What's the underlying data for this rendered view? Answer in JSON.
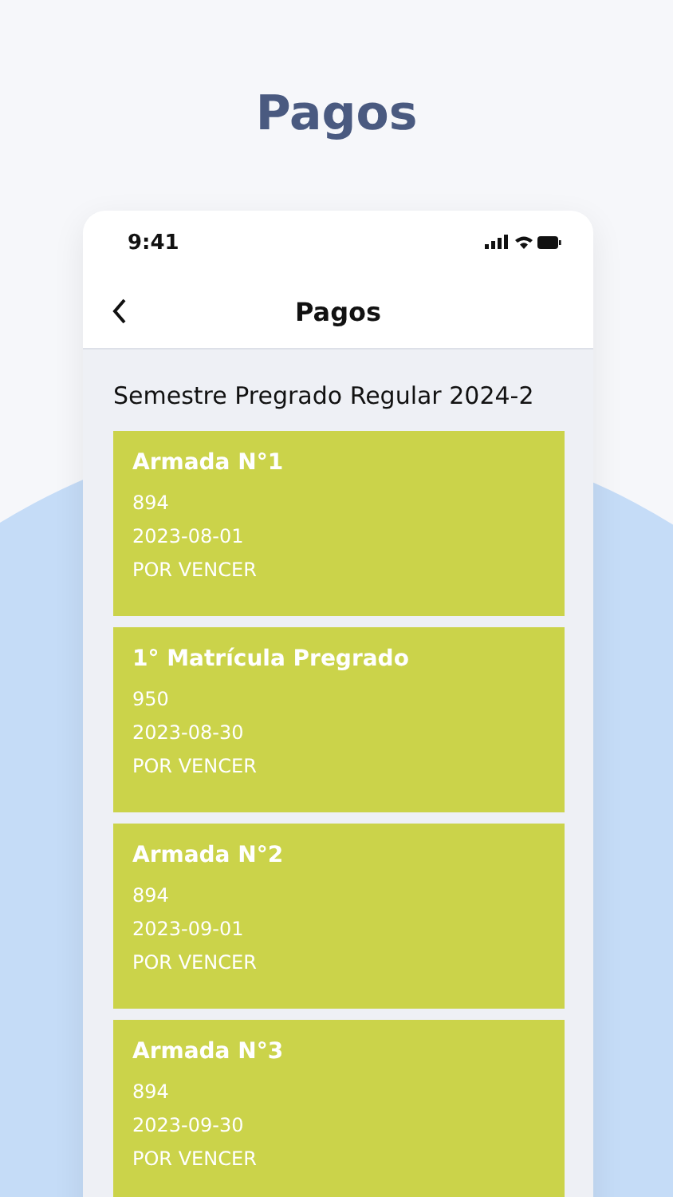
{
  "heading": "Pagos",
  "status_bar": {
    "time": "9:41"
  },
  "nav": {
    "title": "Pagos"
  },
  "section_title": "Semestre Pregrado Regular 2024-2",
  "payments": [
    {
      "title": "Armada N°1",
      "amount": "894",
      "date": "2023-08-01",
      "status": "POR VENCER"
    },
    {
      "title": "1° Matrícula Pregrado",
      "amount": "950",
      "date": "2023-08-30",
      "status": "POR VENCER"
    },
    {
      "title": "Armada N°2",
      "amount": "894",
      "date": "2023-09-01",
      "status": "POR VENCER"
    },
    {
      "title": "Armada N°3",
      "amount": "894",
      "date": "2023-09-30",
      "status": "POR VENCER"
    }
  ]
}
